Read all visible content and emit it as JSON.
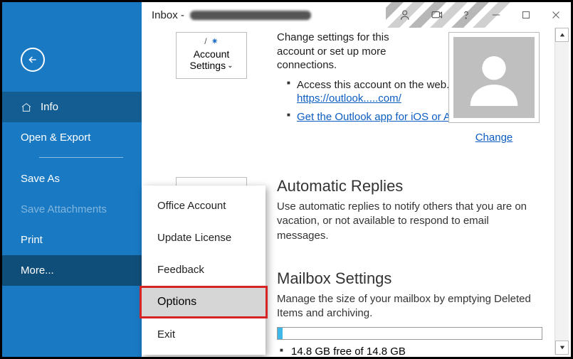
{
  "titlebar": {
    "title": "Inbox -"
  },
  "sidebar": {
    "items": [
      {
        "label": "Info"
      },
      {
        "label": "Open & Export"
      },
      {
        "label": "Save As"
      },
      {
        "label": "Save Attachments"
      },
      {
        "label": "Print"
      },
      {
        "label": "More..."
      }
    ]
  },
  "account_button": {
    "line1": "Account",
    "line2": "Settings"
  },
  "account_info": {
    "desc": "Change settings for this account or set up more connections.",
    "items": [
      {
        "text": "Access this account on the web.",
        "link_label": "https://outlook.....com/"
      },
      {
        "link_label": "Get the Outlook app for iOS or Android."
      }
    ]
  },
  "avatar": {
    "change_label": "Change"
  },
  "sections": {
    "auto_replies": {
      "heading": "Automatic Replies",
      "body": "Use automatic replies to notify others that you are on vacation, or not available to respond to email messages."
    },
    "mailbox": {
      "heading": "Mailbox Settings",
      "body": "Manage the size of your mailbox by emptying Deleted Items and archiving.",
      "free_text": "14.8 GB free of 14.8 GB",
      "used_percent": 2
    }
  },
  "flyout": {
    "items": [
      {
        "label": "Office Account"
      },
      {
        "label": "Update License"
      },
      {
        "label": "Feedback"
      },
      {
        "label": "Options"
      },
      {
        "label": "Exit"
      }
    ]
  }
}
